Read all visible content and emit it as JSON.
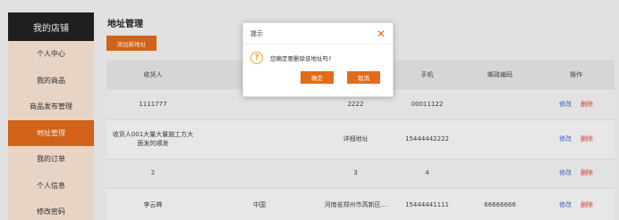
{
  "sidebar": {
    "title": "我的店铺",
    "items": [
      {
        "label": "个人中心"
      },
      {
        "label": "我的商品"
      },
      {
        "label": "商品发布管理"
      },
      {
        "label": "地址管理",
        "active": true
      },
      {
        "label": "我的订单"
      },
      {
        "label": "个人信息"
      },
      {
        "label": "修改密码"
      }
    ]
  },
  "main": {
    "title": "地址管理",
    "add_button": "添加新地址",
    "table": {
      "headers": [
        "收货人",
        "",
        "",
        "手机",
        "邮政编码",
        "操作"
      ],
      "rows": [
        {
          "name": "1111777",
          "region": "",
          "address": "2222",
          "phone": "00011122",
          "zip": "",
          "edit": "修改",
          "del": "删除"
        },
        {
          "name": "收货人001大量大量施工方大面发的顺发",
          "region": "",
          "address": "详细地址",
          "phone": "15444442222",
          "zip": "",
          "edit": "修改",
          "del": "删除"
        },
        {
          "name": "2",
          "region": "",
          "address": "3",
          "phone": "4",
          "zip": "",
          "edit": "修改",
          "del": "删除"
        },
        {
          "name": "李云峰",
          "region": "中国",
          "address": "河南省郑州市高新区...",
          "phone": "15444441111",
          "zip": "66666666",
          "edit": "修改",
          "del": "删除"
        }
      ]
    }
  },
  "modal": {
    "title": "提示",
    "message": "您确定要删除该地址吗?",
    "confirm": "确定",
    "cancel": "取消"
  },
  "colors": {
    "accent": "#e46b1a",
    "sidebar_bg": "#fbe7d6",
    "sidebar_header": "#222222",
    "warn_icon": "#f5a623",
    "link_blue": "#3a6fd8",
    "link_red": "#e0483a"
  }
}
